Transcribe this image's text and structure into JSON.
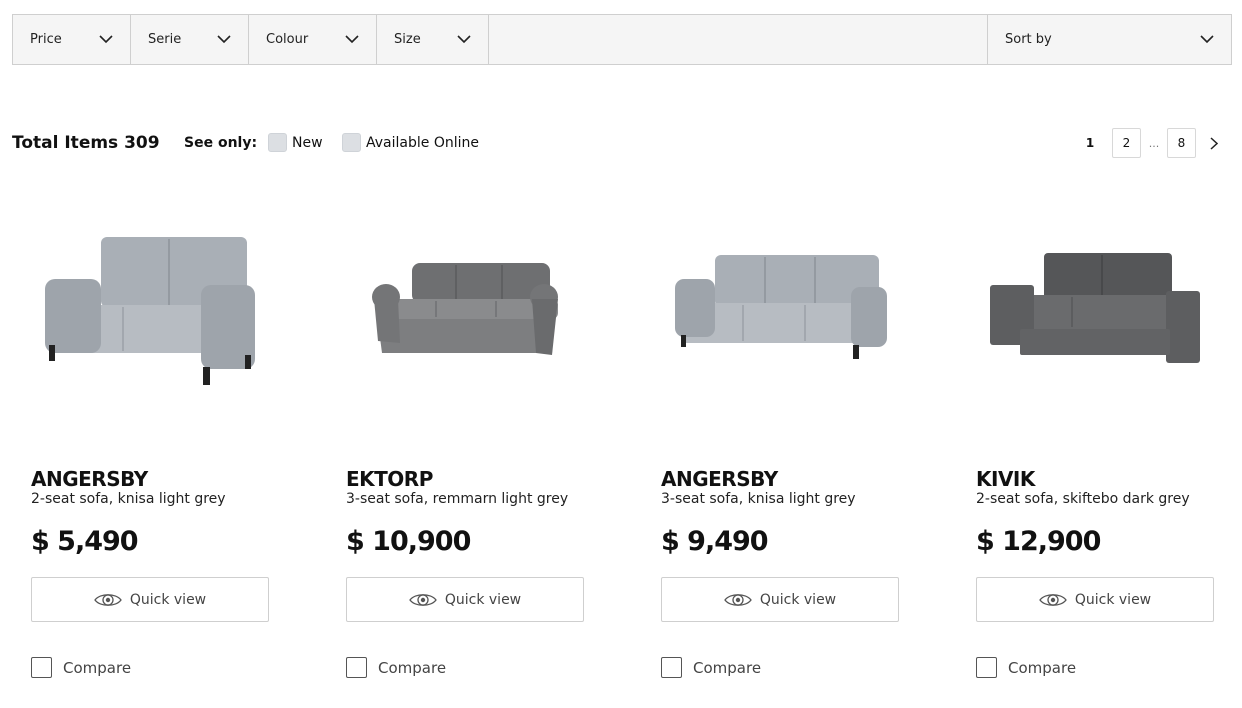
{
  "filters": {
    "price": "Price",
    "serie": "Serie",
    "colour": "Colour",
    "size": "Size",
    "sort": "Sort by"
  },
  "toolbar": {
    "total_items": "Total Items 309",
    "see_only": "See only:",
    "new_label": "New",
    "online_label": "Available Online"
  },
  "pagination": {
    "current": "1",
    "page2": "2",
    "dots": "...",
    "last": "8"
  },
  "products": [
    {
      "name": "ANGERSBY",
      "desc": "2-seat sofa, knisa light grey",
      "price": "$ 5,490",
      "quick_view": "Quick view",
      "compare": "Compare",
      "color": "#a9afb6"
    },
    {
      "name": "EKTORP",
      "desc": "3-seat sofa, remmarn light grey",
      "price": "$ 10,900",
      "quick_view": "Quick view",
      "compare": "Compare",
      "color": "#7d7e80"
    },
    {
      "name": "ANGERSBY",
      "desc": "3-seat sofa, knisa light grey",
      "price": "$ 9,490",
      "quick_view": "Quick view",
      "compare": "Compare",
      "color": "#a9afb6"
    },
    {
      "name": "KIVIK",
      "desc": "2-seat sofa, skiftebo dark grey",
      "price": "$ 12,900",
      "quick_view": "Quick view",
      "compare": "Compare",
      "color": "#5d5e60"
    }
  ]
}
